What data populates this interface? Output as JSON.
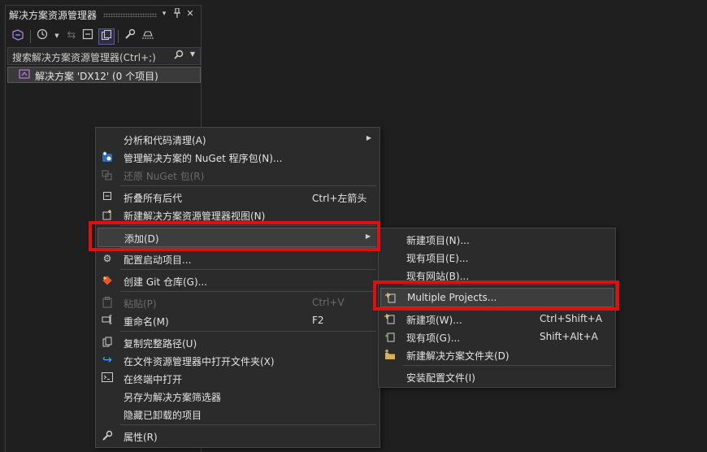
{
  "panel": {
    "title": "解决方案资源管理器",
    "title_buttons": [
      "▾",
      "📌",
      "✕"
    ],
    "search_placeholder": "搜索解决方案资源管理器(Ctrl+;)",
    "tree": {
      "solution_label": "解决方案 'DX12' (0 个项目)"
    },
    "toolbar_icons": [
      "vs-switch-views-icon",
      "history-icon",
      "sync-icon",
      "collapse-all-icon",
      "show-all-files-icon",
      "properties-wrench-icon",
      "preview-icon"
    ]
  },
  "context_menu": {
    "items": [
      {
        "label": "分析和代码清理(A)",
        "submenu": true
      },
      {
        "label": "管理解决方案的 NuGet 程序包(N)..."
      },
      {
        "label": "还原 NuGet 包(R)",
        "disabled": true
      },
      {
        "label": "折叠所有后代",
        "shortcut": "Ctrl+左箭头"
      },
      {
        "label": "新建解决方案资源管理器视图(N)"
      },
      {
        "label": "添加(D)",
        "submenu": true,
        "highlighted": true
      },
      {
        "label": "配置启动项目..."
      },
      {
        "label": "创建 Git 仓库(G)..."
      },
      {
        "label": "粘贴(P)",
        "shortcut": "Ctrl+V",
        "disabled": true
      },
      {
        "label": "重命名(M)",
        "shortcut": "F2"
      },
      {
        "label": "复制完整路径(U)"
      },
      {
        "label": "在文件资源管理器中打开文件夹(X)"
      },
      {
        "label": "在终端中打开"
      },
      {
        "label": "另存为解决方案筛选器"
      },
      {
        "label": "隐藏已卸载的项目"
      },
      {
        "label": "属性(R)"
      }
    ]
  },
  "add_submenu": {
    "items": [
      {
        "label": "新建项目(N)..."
      },
      {
        "label": "现有项目(E)..."
      },
      {
        "label": "现有网站(B)..."
      },
      {
        "label": "Multiple Projects...",
        "highlighted": true
      },
      {
        "label": "新建项(W)...",
        "shortcut": "Ctrl+Shift+A"
      },
      {
        "label": "现有项(G)...",
        "shortcut": "Shift+Alt+A"
      },
      {
        "label": "新建解决方案文件夹(D)"
      },
      {
        "label": "安装配置文件(I)"
      }
    ]
  },
  "colors": {
    "highlight_box": "#e01010",
    "background": "#1f1f1f",
    "menu": "#2b2b2b"
  }
}
